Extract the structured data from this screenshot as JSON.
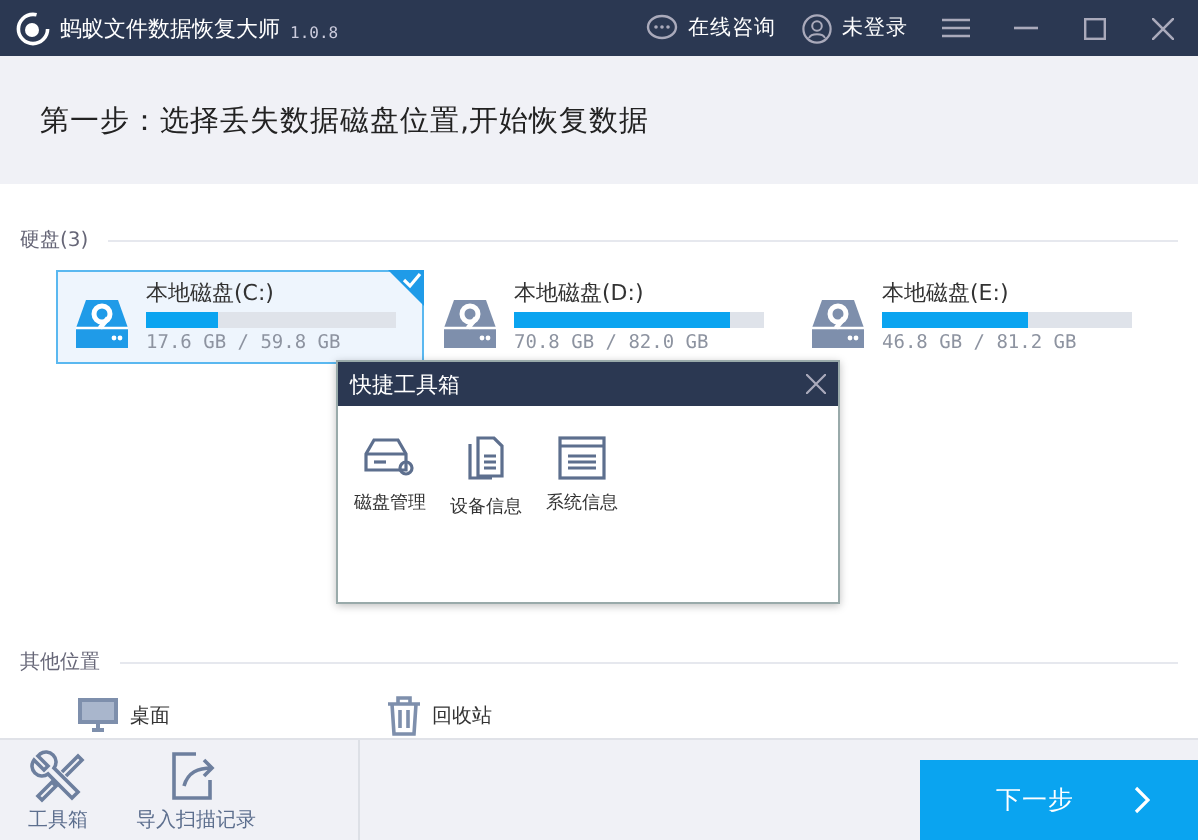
{
  "window": {
    "title": "蚂蚁文件数据恢复大师",
    "version": "1.0.8",
    "consult": "在线咨询",
    "login": "未登录"
  },
  "step": "第一步：选择丢失数据磁盘位置,开始恢复数据",
  "disks_section": {
    "title": "硬盘(3)"
  },
  "disks": [
    {
      "name": "本地磁盘(C:)",
      "usage": "17.6 GB / 59.8 GB",
      "level": 0.29,
      "selected": true
    },
    {
      "name": "本地磁盘(D:)",
      "usage": "70.8 GB / 82.0 GB",
      "level": 0.86,
      "selected": false
    },
    {
      "name": "本地磁盘(E:)",
      "usage": "46.8 GB / 81.2 GB",
      "level": 0.58,
      "selected": false
    }
  ],
  "toolbox_dialog": {
    "title": "快捷工具箱",
    "items": [
      {
        "kind": "disk",
        "label": "磁盘管理"
      },
      {
        "kind": "device",
        "label": "设备信息"
      },
      {
        "kind": "system",
        "label": "系统信息"
      }
    ]
  },
  "other_section": {
    "title": "其他位置",
    "items": [
      {
        "kind": "desktop",
        "label": "桌面"
      },
      {
        "kind": "recycle",
        "label": "回收站"
      }
    ]
  },
  "bottom_bar": {
    "tools": [
      {
        "kind": "toolbox",
        "label": "工具箱"
      },
      {
        "kind": "import",
        "label": "导入扫描记录"
      }
    ],
    "next_button": "下一步"
  }
}
